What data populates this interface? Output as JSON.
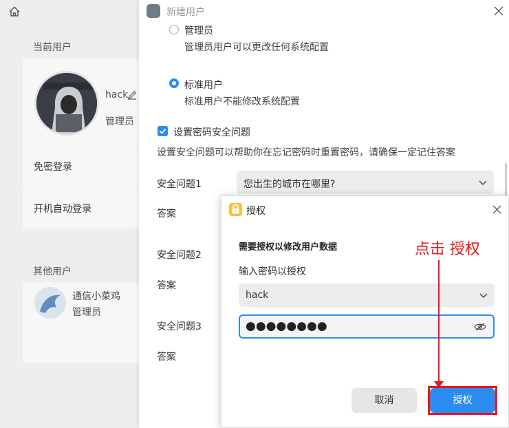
{
  "sidebar": {
    "current_users_title": "当前用户",
    "current_user": {
      "name": "hack",
      "role": "管理员"
    },
    "passwordless_login": "免密登录",
    "auto_login": "开机自动登录",
    "other_users_title": "其他用户",
    "other_user": {
      "name": "通信小菜鸡",
      "role": "管理员"
    }
  },
  "new_user_dialog": {
    "title": "新建用户",
    "admin_option": {
      "label": "管理员",
      "desc": "管理员用户可以更改任何系统配置",
      "selected": false
    },
    "standard_option": {
      "label": "标准用户",
      "desc": "标准用户不能修改系统配置",
      "selected": true
    },
    "security_checkbox": {
      "label": "设置密码安全问题",
      "checked": true
    },
    "security_desc": "设置安全问题可以帮助你在忘记密码时重置密码，请确保一定记住答案",
    "questions": [
      {
        "label": "安全问题1",
        "value": "您出生的城市在哪里?",
        "answer_label": "答案"
      },
      {
        "label": "安全问题2",
        "answer_label": "答案"
      },
      {
        "label": "安全问题3",
        "answer_label": "答案"
      }
    ]
  },
  "auth_dialog": {
    "title": "授权",
    "heading": "需要授权以修改用户数据",
    "password_label": "输入密码以授权",
    "user_select": "hack",
    "password_masked": "●●●●●●●●",
    "cancel_label": "取消",
    "authorize_label": "授权"
  },
  "annotation": {
    "text": "点击 授权",
    "color": "#e8161b"
  },
  "colors": {
    "accent": "#2d8cf0",
    "highlight": "#e8161b"
  }
}
